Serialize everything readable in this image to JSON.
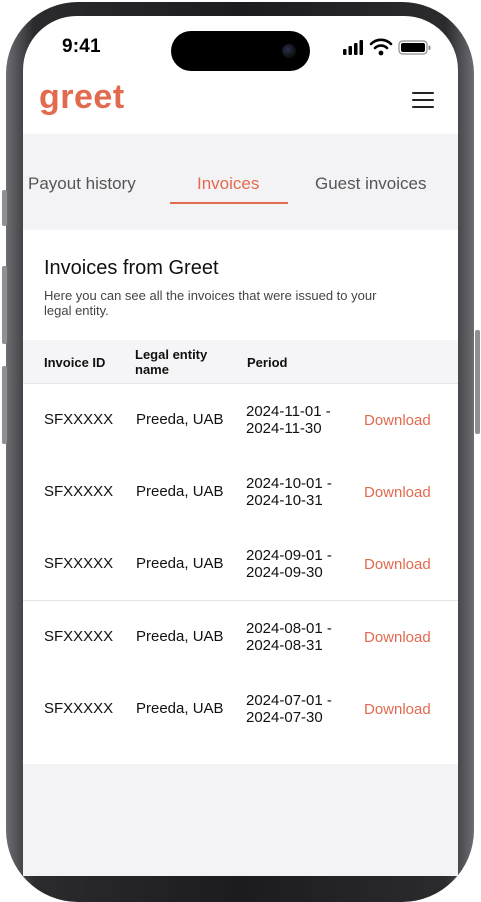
{
  "status_bar": {
    "time": "9:41"
  },
  "header": {
    "logo": "greet",
    "menu_icon": "hamburger-menu-icon"
  },
  "tabs": [
    {
      "label": "Payout history",
      "active": false
    },
    {
      "label": "Invoices",
      "active": true
    },
    {
      "label": "Guest invoices",
      "active": false
    }
  ],
  "invoices": {
    "title": "Invoices from Greet",
    "description": "Here you can see all the invoices that were issued to your legal entity.",
    "columns": {
      "id": "Invoice ID",
      "entity": "Legal entity name",
      "period": "Period"
    },
    "rows": [
      {
        "id": "SFXXXXX",
        "entity": "Preeda, UAB",
        "period": "2024-11-01 - 2024-11-30",
        "action": "Download"
      },
      {
        "id": "SFXXXXX",
        "entity": "Preeda, UAB",
        "period": "2024-10-01 - 2024-10-31",
        "action": "Download"
      },
      {
        "id": "SFXXXXX",
        "entity": "Preeda, UAB",
        "period": "2024-09-01 - 2024-09-30",
        "action": "Download"
      },
      {
        "id": "SFXXXXX",
        "entity": "Preeda, UAB",
        "period": "2024-08-01 - 2024-08-31",
        "action": "Download"
      },
      {
        "id": "SFXXXXX",
        "entity": "Preeda, UAB",
        "period": "2024-07-01 - 2024-07-30",
        "action": "Download"
      }
    ]
  },
  "colors": {
    "accent": "#e36a4f",
    "background_grey": "#f3f3f5"
  }
}
